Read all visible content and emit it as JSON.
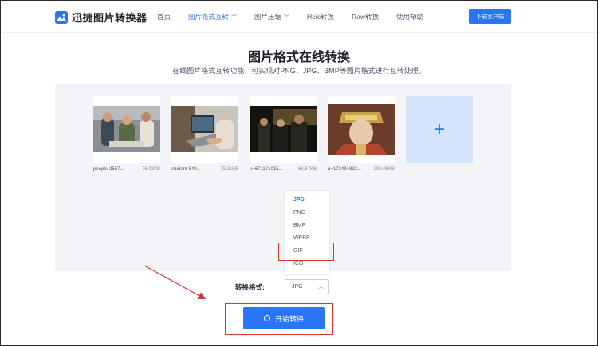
{
  "header": {
    "brand": "迅捷图片转换器",
    "nav": [
      {
        "label": "首页",
        "active": false,
        "has_dropdown": false
      },
      {
        "label": "图片格式互转",
        "active": true,
        "has_dropdown": true
      },
      {
        "label": "图片压缩",
        "active": false,
        "has_dropdown": true
      },
      {
        "label": "Heic转换",
        "active": false,
        "has_dropdown": false
      },
      {
        "label": "Raw转换",
        "active": false,
        "has_dropdown": false
      },
      {
        "label": "使用帮助",
        "active": false,
        "has_dropdown": false
      }
    ],
    "download_label": "下载客户端"
  },
  "main": {
    "title": "图片格式在线转换",
    "subtitle": "在线图片格式互转功能，可实现对PNG、JPG、BMP等图片格式进行互转处理。"
  },
  "files": [
    {
      "name": "people-2557...",
      "size": "76.03KB"
    },
    {
      "name": "student-849...",
      "size": "75.11KB"
    },
    {
      "name": "u=671171015...",
      "size": "68.67KB"
    },
    {
      "name": "u=172494832...",
      "size": "208.06KB"
    }
  ],
  "add_tile": {
    "icon": "plus-icon"
  },
  "dropdown": {
    "options": [
      "JPG",
      "PNG",
      "BMP",
      "WEBP",
      "GIF",
      "ICO"
    ],
    "selected": "JPG",
    "highlighted": "GIF"
  },
  "format": {
    "label": "转换格式:",
    "value": "JPG"
  },
  "start_button": {
    "label": "开始转换"
  },
  "colors": {
    "accent": "#2a74f6",
    "annotation": "#d9372d"
  }
}
